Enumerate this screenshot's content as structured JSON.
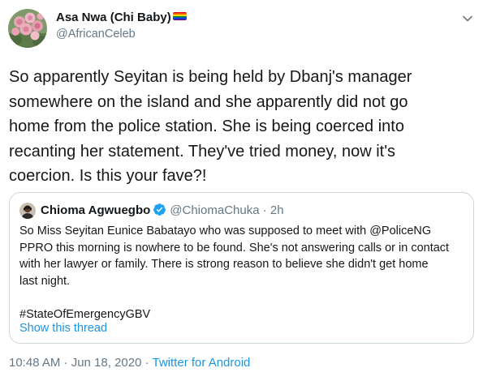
{
  "author": {
    "display_name": "Asa Nwa (Chi Baby)",
    "handle": "@AfricanCeleb",
    "avatar_icon": "rose-bouquet-avatar",
    "name_emoji_icon": "rainbow-flag-icon"
  },
  "menu_icon": "chevron-down-icon",
  "tweet_lines": [
    "So apparently Seyitan is being held by Dbanj's manager",
    "somewhere on the island and she apparently did not go",
    "home from the police station. She is being coerced into",
    "recanting her statement. They've tried money, now it's",
    "coercion. Is this your fave?!"
  ],
  "quote": {
    "name": "Chioma Agwuegbo",
    "handle": "@ChiomaChuka",
    "dot": "·",
    "time": "2h",
    "verified_icon": "verified-badge-icon",
    "lines": [
      "So Miss Seyitan Eunice Babatayo who was supposed to meet with @PoliceNG",
      "PPRO this morning is nowhere to be found. She's not answering calls or in contact",
      "with her lawyer or family. There is strong reason to believe she didn't get home",
      "last night."
    ],
    "hashtag": "#StateOfEmergencyGBV",
    "show_thread": "Show this thread"
  },
  "meta": {
    "timestamp": "10:48 AM · Jun 18, 2020 · ",
    "source": "Twitter for Android"
  },
  "colors": {
    "text": "#14171a",
    "secondary": "#657786",
    "link": "#1b95e0",
    "border": "#ccd6dd"
  }
}
